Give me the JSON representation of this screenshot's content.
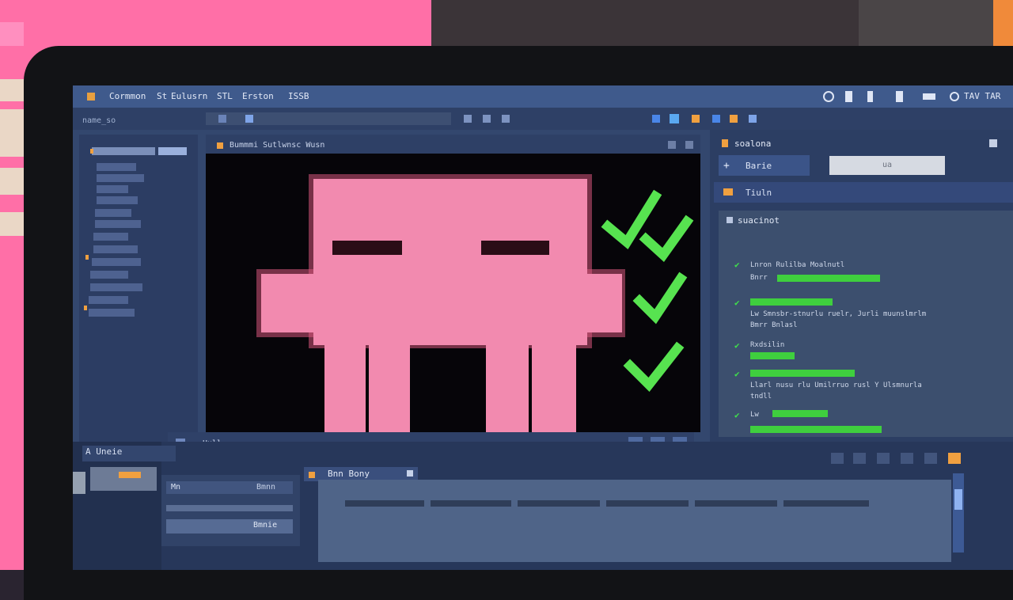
{
  "menubar": {
    "items": [
      "Cormmon",
      "St",
      "Eulusrn",
      "STL",
      "Erston",
      "ISSB"
    ],
    "status_text": "TAV TAR"
  },
  "toolbar": {
    "file_label": "name_so",
    "path_text": ""
  },
  "viewport": {
    "title": "Bummmi Sutlwnsc Wusn",
    "mode_label": "Uull"
  },
  "right_panel": {
    "title": "soalona",
    "add_button_label": "Barie",
    "field_value": "ua",
    "section_label": "Tiuln",
    "output_title": "suacinot",
    "log": [
      {
        "text": "Lnron Rulilba Moalnutl",
        "sub": "Bnrr"
      },
      {
        "text": "Lw Smnsbr-stnurlu ruelr, Jurli muunslmrlm",
        "sub": "Bmrr Bnlasl"
      },
      {
        "text": "Rxdsilin",
        "sub": ""
      },
      {
        "text": "Llarl nusu rlu Umilrruo rusl Y Ulsmnurla",
        "sub": "tndll"
      },
      {
        "text": "Lw",
        "sub": ""
      }
    ]
  },
  "dock": {
    "tab_label": "A Uneie",
    "inspector_label": "Mn",
    "inspector_value": "Bmnn",
    "inspector_button": "Bmnie",
    "timeline_label": "Bnn Bony"
  },
  "colors": {
    "character_pink": "#f28aaf",
    "character_outline": "#d7567b",
    "check_green": "#57e350",
    "accent_orange": "#f0a040"
  }
}
